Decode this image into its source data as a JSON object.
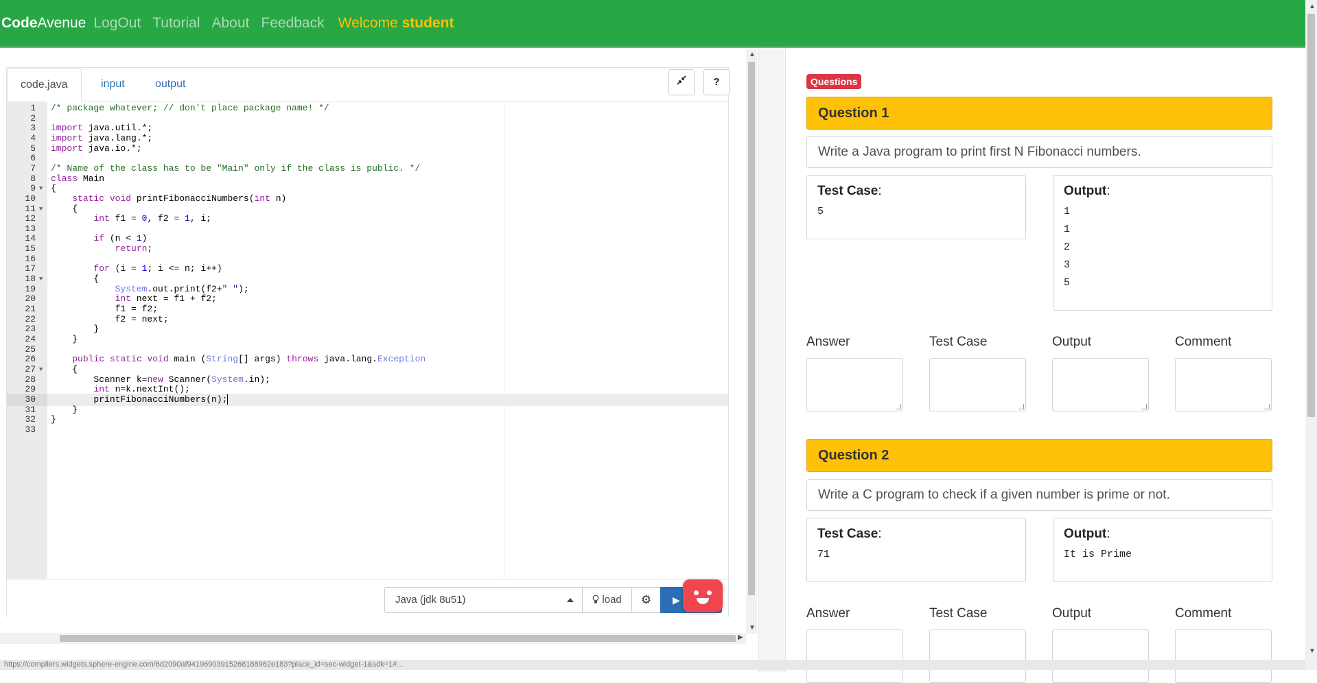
{
  "navbar": {
    "brand_bold": "Code",
    "brand_rest": "Avenue",
    "links": [
      "LogOut",
      "Tutorial",
      "About",
      "Feedback"
    ],
    "welcome_prefix": "Welcome",
    "welcome_user": "student",
    "colors": {
      "bg": "#28a745",
      "welcome": "#ffc107"
    }
  },
  "editor": {
    "tabs": [
      "code.java",
      "input",
      "output"
    ],
    "active_tab": "code.java",
    "tool_buttons": {
      "collapse_icon": "compress-icon",
      "help_label": "?"
    },
    "active_line": 30,
    "language": "Java (jdk 8u51)",
    "load_label": "load",
    "run_icon": "play-icon"
  },
  "right": {
    "badge": "Questions",
    "questions": [
      {
        "title": "Question 1",
        "text": "Write a Java program to print first N Fibonacci numbers.",
        "test_case_label": "Test Case",
        "test_case_value": "5",
        "output_label": "Output",
        "output_values": [
          "1",
          "1",
          "2",
          "3",
          "5"
        ]
      },
      {
        "title": "Question 2",
        "text": "Write a C program to check if a given number is prime or not.",
        "test_case_label": "Test Case",
        "test_case_value": "71",
        "output_label": "Output",
        "output_values": [
          "It is Prime"
        ]
      }
    ],
    "fields": [
      "Answer",
      "Test Case",
      "Output",
      "Comment"
    ]
  },
  "status_url": "https://compilers.widgets.sphere-engine.com/6d2090af9419690391526818​8962e183?place_id=sec-widget-1&sdk=1#..."
}
